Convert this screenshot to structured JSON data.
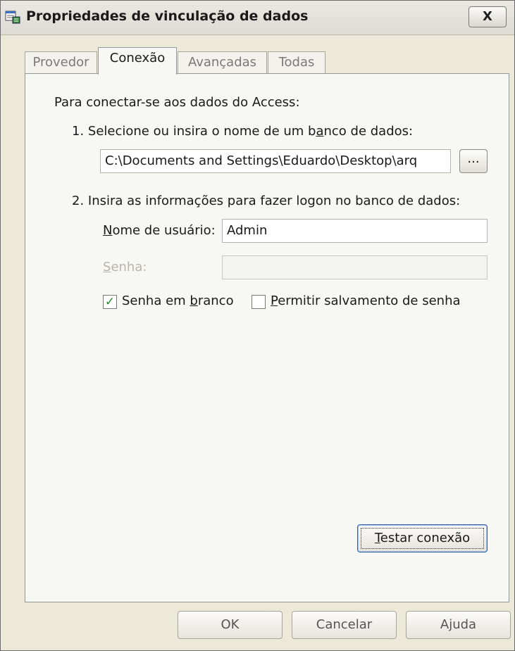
{
  "window": {
    "title": "Propriedades de vinculação de dados",
    "close_label": "X"
  },
  "tabs": [
    {
      "label": "Provedor",
      "active": false
    },
    {
      "label": "Conexão",
      "active": true
    },
    {
      "label": "Avançadas",
      "active": false
    },
    {
      "label": "Todas",
      "active": false
    }
  ],
  "connection": {
    "intro": "Para conectar-se aos dados do Access:",
    "step1": {
      "pre": "1. Selecione ou insira o nome de um b",
      "mnemonic": "a",
      "post": "nco de dados:",
      "db_path": "C:\\Documents and Settings\\Eduardo\\Desktop\\arq",
      "browse_label": "..."
    },
    "step2": {
      "label": "2. Insira as informações para fazer logon no banco de dados:",
      "username_label_mn": "N",
      "username_label_rest": "ome de usuário:",
      "username_value": "Admin",
      "password_label_mn": "S",
      "password_label_rest": "enha:",
      "password_value": ""
    },
    "blank_password": {
      "pre": "Senha em ",
      "mnemonic": "b",
      "post": "ranco",
      "checked": true,
      "check_glyph": "✓"
    },
    "allow_save": {
      "mnemonic": "P",
      "post": "ermitir salvamento de senha",
      "checked": false
    },
    "test_button": {
      "mnemonic": "T",
      "post": "estar conexão"
    }
  },
  "footer": {
    "ok": "OK",
    "cancel": "Cancelar",
    "help": "Ajuda"
  }
}
